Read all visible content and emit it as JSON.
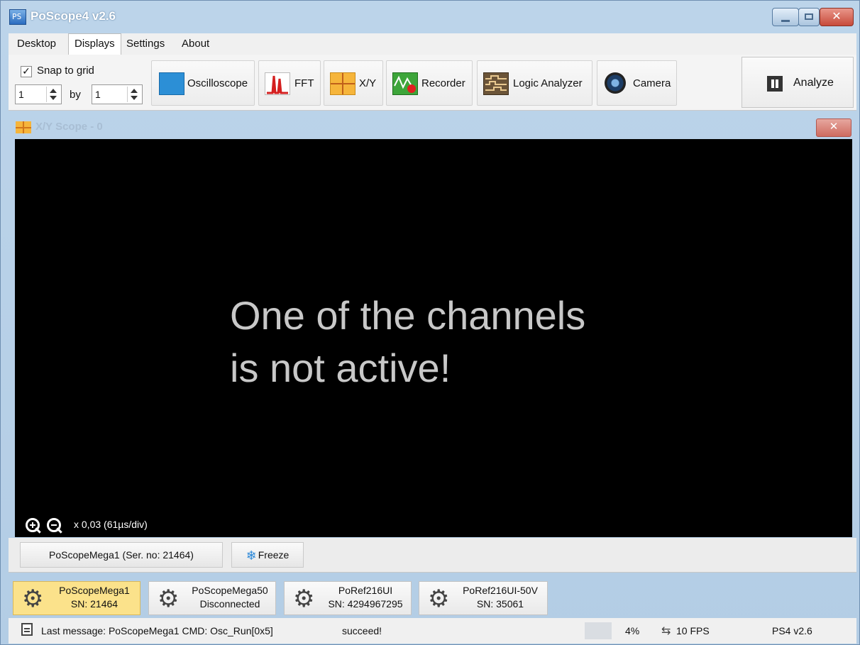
{
  "window": {
    "title": "PoScope4 v2.6",
    "icon_text": "PS",
    "close_glyph": "✕"
  },
  "menu": {
    "tabs": [
      {
        "label": "Desktop"
      },
      {
        "label": "Displays"
      },
      {
        "label": "Settings"
      },
      {
        "label": "About"
      }
    ],
    "active": "Displays"
  },
  "toolbar": {
    "snap_to_grid": {
      "checked": true,
      "check_glyph": "✓",
      "label": "Snap to grid"
    },
    "grid_x": "1",
    "by_label": "by",
    "grid_y": "1",
    "buttons": [
      {
        "label": "Oscilloscope",
        "icon": "oscilloscope-icon"
      },
      {
        "label": "FFT",
        "icon": "fft-icon"
      },
      {
        "label": "X/Y",
        "icon": "xy-icon"
      },
      {
        "label": "Recorder",
        "icon": "recorder-icon"
      },
      {
        "label": "Logic Analyzer",
        "icon": "logic-analyzer-icon"
      },
      {
        "label": "Camera",
        "icon": "camera-icon"
      }
    ],
    "analyze": {
      "label": "Analyze",
      "icon": "pause-icon"
    }
  },
  "scope": {
    "title": "X/Y Scope - 0",
    "close_glyph": "✕",
    "message_line1": "One of the channels",
    "message_line2": "is not active!",
    "zoom_text": "x 0,03 (61µs/div)",
    "device_button": "PoScopeMega1 (Ser. no: 21464)",
    "freeze_label": "Freeze",
    "freeze_glyph": "❄"
  },
  "devices": [
    {
      "name": "PoScopeMega1",
      "sub": "SN: 21464",
      "active": true
    },
    {
      "name": "PoScopeMega50",
      "sub": "Disconnected",
      "active": false
    },
    {
      "name": "PoRef216UI",
      "sub": "SN: 4294967295",
      "active": false
    },
    {
      "name": "PoRef216UI-50V",
      "sub": "SN: 35061",
      "active": false
    }
  ],
  "gear_glyph": "⚙",
  "status": {
    "last_message": "Last message: PoScopeMega1 CMD: Osc_Run[0x5]",
    "result": "succeed!",
    "cpu": "4%",
    "fps": "10 FPS",
    "fps_glyph": "⇆",
    "version": "PS4 v2.6"
  },
  "colors": {
    "window_frame": "#b3cde5",
    "active_device": "#fbe28b",
    "scope_background": "#000000",
    "message_text": "#c8c8c8"
  }
}
